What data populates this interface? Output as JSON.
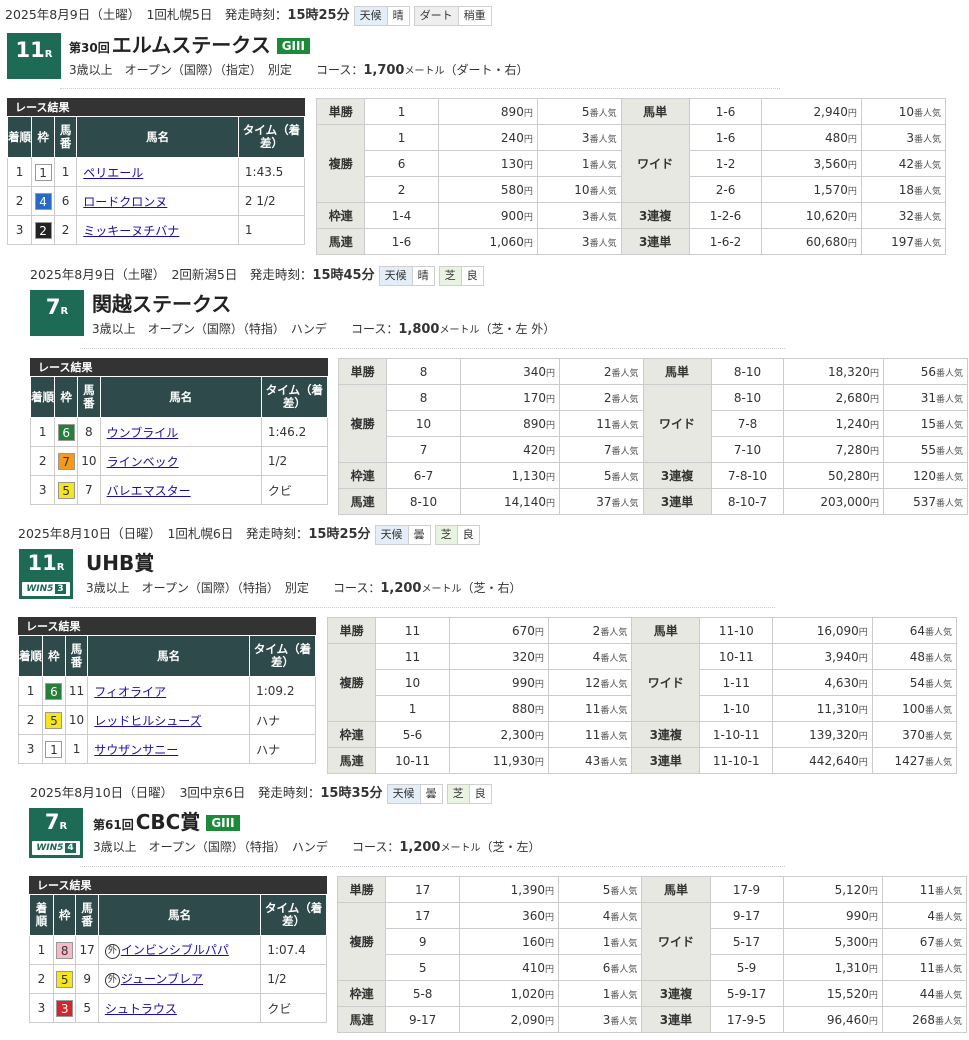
{
  "labels": {
    "yen": "円",
    "ninki": "番人気",
    "result": "レース結果",
    "h_chaku": "着順",
    "h_waku": "枠",
    "h_uma": "馬番",
    "h_name": "馬名",
    "h_time": "タイム（着差）",
    "tenki": "天候"
  },
  "races": [
    {
      "date": "2025年8月9日（土曜）",
      "meet": "1回札幌5日",
      "start_label": "発走時刻：",
      "start": "15時25分",
      "weather": "晴",
      "surface": "ダート",
      "cond": "稍重",
      "rnum": "11",
      "rsuffix": "R",
      "win5": "",
      "kai": "第30回",
      "name": "エルムステークス",
      "grade": "GIII",
      "cond_text": "3歳以上　オープン（国際）（指定）　別定",
      "course_label": "コース：",
      "course": "1,700",
      "course_unit": "メートル",
      "course_detail": "（ダート・右）",
      "results": [
        {
          "pos": "1",
          "waku": "1",
          "uma": "1",
          "name": "ペリエール",
          "gai": false,
          "time": "1:43.5"
        },
        {
          "pos": "2",
          "waku": "4",
          "uma": "6",
          "name": "ロードクロンヌ",
          "gai": false,
          "time": "2 1/2"
        },
        {
          "pos": "3",
          "waku": "2",
          "uma": "2",
          "name": "ミッキーヌチバナ",
          "gai": false,
          "time": "1"
        }
      ],
      "pay": {
        "tansho": {
          "label": "単勝",
          "k": "1",
          "y": "890",
          "n": "5"
        },
        "fukusho": {
          "label": "複勝",
          "rows": [
            {
              "k": "1",
              "y": "240",
              "n": "3"
            },
            {
              "k": "6",
              "y": "130",
              "n": "1"
            },
            {
              "k": "2",
              "y": "580",
              "n": "10"
            }
          ]
        },
        "wakuren": {
          "label": "枠連",
          "k": "1-4",
          "y": "900",
          "n": "3"
        },
        "umaren": {
          "label": "馬連",
          "k": "1-6",
          "y": "1,060",
          "n": "3"
        },
        "umatan": {
          "label": "馬単",
          "k": "1-6",
          "y": "2,940",
          "n": "10"
        },
        "wide": {
          "label": "ワイド",
          "rows": [
            {
              "k": "1-6",
              "y": "480",
              "n": "3"
            },
            {
              "k": "1-2",
              "y": "3,560",
              "n": "42"
            },
            {
              "k": "2-6",
              "y": "1,570",
              "n": "18"
            }
          ]
        },
        "sanfuku": {
          "label": "3連複",
          "k": "1-2-6",
          "y": "10,620",
          "n": "32"
        },
        "santan": {
          "label": "3連単",
          "k": "1-6-2",
          "y": "60,680",
          "n": "197"
        }
      }
    },
    {
      "date": "2025年8月9日（土曜）",
      "meet": "2回新潟5日",
      "start_label": "発走時刻：",
      "start": "15時45分",
      "weather": "晴",
      "surface": "芝",
      "cond": "良",
      "rnum": "7",
      "rsuffix": "R",
      "win5": "",
      "kai": "",
      "name": "関越ステークス",
      "grade": "",
      "cond_text": "3歳以上　オープン（国際）（特指）　ハンデ",
      "course_label": "コース：",
      "course": "1,800",
      "course_unit": "メートル",
      "course_detail": "（芝・左 外）",
      "results": [
        {
          "pos": "1",
          "waku": "6",
          "uma": "8",
          "name": "ウンブライル",
          "gai": false,
          "time": "1:46.2"
        },
        {
          "pos": "2",
          "waku": "7",
          "uma": "10",
          "name": "ラインベック",
          "gai": false,
          "time": "1/2"
        },
        {
          "pos": "3",
          "waku": "5",
          "uma": "7",
          "name": "バレエマスター",
          "gai": false,
          "time": "クビ"
        }
      ],
      "pay": {
        "tansho": {
          "label": "単勝",
          "k": "8",
          "y": "340",
          "n": "2"
        },
        "fukusho": {
          "label": "複勝",
          "rows": [
            {
              "k": "8",
              "y": "170",
              "n": "2"
            },
            {
              "k": "10",
              "y": "890",
              "n": "11"
            },
            {
              "k": "7",
              "y": "420",
              "n": "7"
            }
          ]
        },
        "wakuren": {
          "label": "枠連",
          "k": "6-7",
          "y": "1,130",
          "n": "5"
        },
        "umaren": {
          "label": "馬連",
          "k": "8-10",
          "y": "14,140",
          "n": "37"
        },
        "umatan": {
          "label": "馬単",
          "k": "8-10",
          "y": "18,320",
          "n": "56"
        },
        "wide": {
          "label": "ワイド",
          "rows": [
            {
              "k": "8-10",
              "y": "2,680",
              "n": "31"
            },
            {
              "k": "7-8",
              "y": "1,240",
              "n": "15"
            },
            {
              "k": "7-10",
              "y": "7,280",
              "n": "55"
            }
          ]
        },
        "sanfuku": {
          "label": "3連複",
          "k": "7-8-10",
          "y": "50,280",
          "n": "120"
        },
        "santan": {
          "label": "3連単",
          "k": "8-10-7",
          "y": "203,000",
          "n": "537"
        }
      }
    },
    {
      "date": "2025年8月10日（日曜）",
      "meet": "1回札幌6日",
      "start_label": "発走時刻：",
      "start": "15時25分",
      "weather": "曇",
      "surface": "芝",
      "cond": "良",
      "rnum": "11",
      "rsuffix": "R",
      "win5": "3",
      "kai": "",
      "name": "UHB賞",
      "grade": "",
      "cond_text": "3歳以上　オープン（国際）（特指）　別定",
      "course_label": "コース：",
      "course": "1,200",
      "course_unit": "メートル",
      "course_detail": "（芝・右）",
      "results": [
        {
          "pos": "1",
          "waku": "6",
          "uma": "11",
          "name": "フィオライア",
          "gai": false,
          "time": "1:09.2"
        },
        {
          "pos": "2",
          "waku": "5",
          "uma": "10",
          "name": "レッドヒルシューズ",
          "gai": false,
          "time": "ハナ"
        },
        {
          "pos": "3",
          "waku": "1",
          "uma": "1",
          "name": "サウザンサニー",
          "gai": false,
          "time": "ハナ"
        }
      ],
      "pay": {
        "tansho": {
          "label": "単勝",
          "k": "11",
          "y": "670",
          "n": "2"
        },
        "fukusho": {
          "label": "複勝",
          "rows": [
            {
              "k": "11",
              "y": "320",
              "n": "4"
            },
            {
              "k": "10",
              "y": "990",
              "n": "12"
            },
            {
              "k": "1",
              "y": "880",
              "n": "11"
            }
          ]
        },
        "wakuren": {
          "label": "枠連",
          "k": "5-6",
          "y": "2,300",
          "n": "11"
        },
        "umaren": {
          "label": "馬連",
          "k": "10-11",
          "y": "11,930",
          "n": "43"
        },
        "umatan": {
          "label": "馬単",
          "k": "11-10",
          "y": "16,090",
          "n": "64"
        },
        "wide": {
          "label": "ワイド",
          "rows": [
            {
              "k": "10-11",
              "y": "3,940",
              "n": "48"
            },
            {
              "k": "1-11",
              "y": "4,630",
              "n": "54"
            },
            {
              "k": "1-10",
              "y": "11,310",
              "n": "100"
            }
          ]
        },
        "sanfuku": {
          "label": "3連複",
          "k": "1-10-11",
          "y": "139,320",
          "n": "370"
        },
        "santan": {
          "label": "3連単",
          "k": "11-10-1",
          "y": "442,640",
          "n": "1427"
        }
      }
    },
    {
      "date": "2025年8月10日（日曜）",
      "meet": "3回中京6日",
      "start_label": "発走時刻：",
      "start": "15時35分",
      "weather": "曇",
      "surface": "芝",
      "cond": "良",
      "rnum": "7",
      "rsuffix": "R",
      "win5": "4",
      "kai": "第61回",
      "name": "CBC賞",
      "grade": "GIII",
      "cond_text": "3歳以上　オープン（国際）（特指）　ハンデ",
      "course_label": "コース：",
      "course": "1,200",
      "course_unit": "メートル",
      "course_detail": "（芝・左）",
      "results": [
        {
          "pos": "1",
          "waku": "8",
          "uma": "17",
          "name": "インビンシブルパパ",
          "gai": true,
          "time": "1:07.4"
        },
        {
          "pos": "2",
          "waku": "5",
          "uma": "9",
          "name": "ジューンブレア",
          "gai": true,
          "time": "1/2"
        },
        {
          "pos": "3",
          "waku": "3",
          "uma": "5",
          "name": "シュトラウス",
          "gai": false,
          "time": "クビ"
        }
      ],
      "pay": {
        "tansho": {
          "label": "単勝",
          "k": "17",
          "y": "1,390",
          "n": "5"
        },
        "fukusho": {
          "label": "複勝",
          "rows": [
            {
              "k": "17",
              "y": "360",
              "n": "4"
            },
            {
              "k": "9",
              "y": "160",
              "n": "1"
            },
            {
              "k": "5",
              "y": "410",
              "n": "6"
            }
          ]
        },
        "wakuren": {
          "label": "枠連",
          "k": "5-8",
          "y": "1,020",
          "n": "1"
        },
        "umaren": {
          "label": "馬連",
          "k": "9-17",
          "y": "2,090",
          "n": "3"
        },
        "umatan": {
          "label": "馬単",
          "k": "17-9",
          "y": "5,120",
          "n": "11"
        },
        "wide": {
          "label": "ワイド",
          "rows": [
            {
              "k": "9-17",
              "y": "990",
              "n": "4"
            },
            {
              "k": "5-17",
              "y": "5,300",
              "n": "67"
            },
            {
              "k": "5-9",
              "y": "1,310",
              "n": "11"
            }
          ]
        },
        "sanfuku": {
          "label": "3連複",
          "k": "5-9-17",
          "y": "15,520",
          "n": "44"
        },
        "santan": {
          "label": "3連単",
          "k": "17-9-5",
          "y": "96,460",
          "n": "268"
        }
      }
    }
  ],
  "gai_mark": "外",
  "win5_text": "WIN5",
  "waku_colors": {
    "1": "#ffffff",
    "2": "#222222",
    "3": "#d6252a",
    "4": "#2769c6",
    "5": "#f5e51c",
    "6": "#27803a",
    "7": "#f39a1a",
    "8": "#f6b9c8"
  },
  "waku_text": {
    "1": "#333",
    "2": "#fff",
    "3": "#fff",
    "4": "#fff",
    "5": "#333",
    "6": "#fff",
    "7": "#333",
    "8": "#333"
  }
}
